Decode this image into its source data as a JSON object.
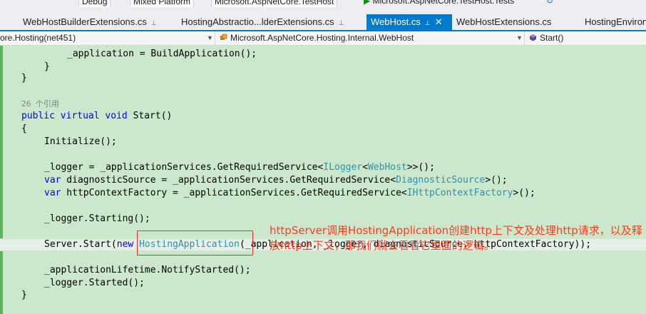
{
  "toolbar": {
    "config": "Debug",
    "platform": "Mixed Platform",
    "startup_project": "Microsoft.AspNetCore.TestHost",
    "test_project": "Microsoft.AspNetCore.TestHost.Tests"
  },
  "tabs": [
    {
      "label": "WebHostBuilderExtensions.cs",
      "pin": "⊥",
      "active": false
    },
    {
      "label": "HostingAbstractio...lderExtensions.cs",
      "pin": "⊥",
      "active": false
    },
    {
      "label": "WebHost.cs",
      "pin": "⊥",
      "close": "✕",
      "active": true
    },
    {
      "label": "WebHostExtensions.cs",
      "active": false
    },
    {
      "label": "HostingEnviron",
      "active": false
    }
  ],
  "navbar": {
    "project": "ore.Hosting(net451)",
    "type": "Microsoft.AspNetCore.Hosting.Internal.WebHost",
    "member": "Start()"
  },
  "code": {
    "l1": "_application = BuildApplication();",
    "l2": "}",
    "l3": "}",
    "ref_count": "26 个引用",
    "kw_public": "public",
    "kw_virtual": "virtual",
    "kw_void": "void",
    "method": "Start()",
    "open_brace": "{",
    "initialize": "Initialize();",
    "logger_a": "_logger = _applicationServices.GetRequiredService<",
    "logger_t1": "ILogger",
    "logger_lt": "<",
    "logger_t2": "WebHost",
    "logger_b": ">>();",
    "kw_var": "var",
    "diag_a": " diagnosticSource = _applicationServices.GetRequiredService<",
    "diag_t": "DiagnosticSource",
    "diag_b": ">();",
    "http_a": " httpContextFactory = _applicationServices.GetRequiredService<",
    "http_t": "IHttpContextFactory",
    "http_b": ">();",
    "starting": "_logger.Starting();",
    "server_a": "Server.Start(",
    "kw_new": "new",
    "hosting_app": "HostingApplication",
    "server_b": "(_application, _logger, diagnosticSource, httpContextFactory));",
    "notify": "_applicationLifetime.NotifyStarted();",
    "started": "_logger.Started();",
    "close_brace": "}"
  },
  "annotation": {
    "text": "httpServer调用HostingApplication创建http上下文及处理http请求，以及释放http上下文，那我们就去看看它里面的逻辑。",
    "color": "#ff3b1f"
  },
  "colors": {
    "editor_bg": "#cce8cc",
    "keyword": "#0000ff",
    "type": "#2b91af",
    "accent": "#007acc",
    "highlight_box": "#e8322a"
  }
}
